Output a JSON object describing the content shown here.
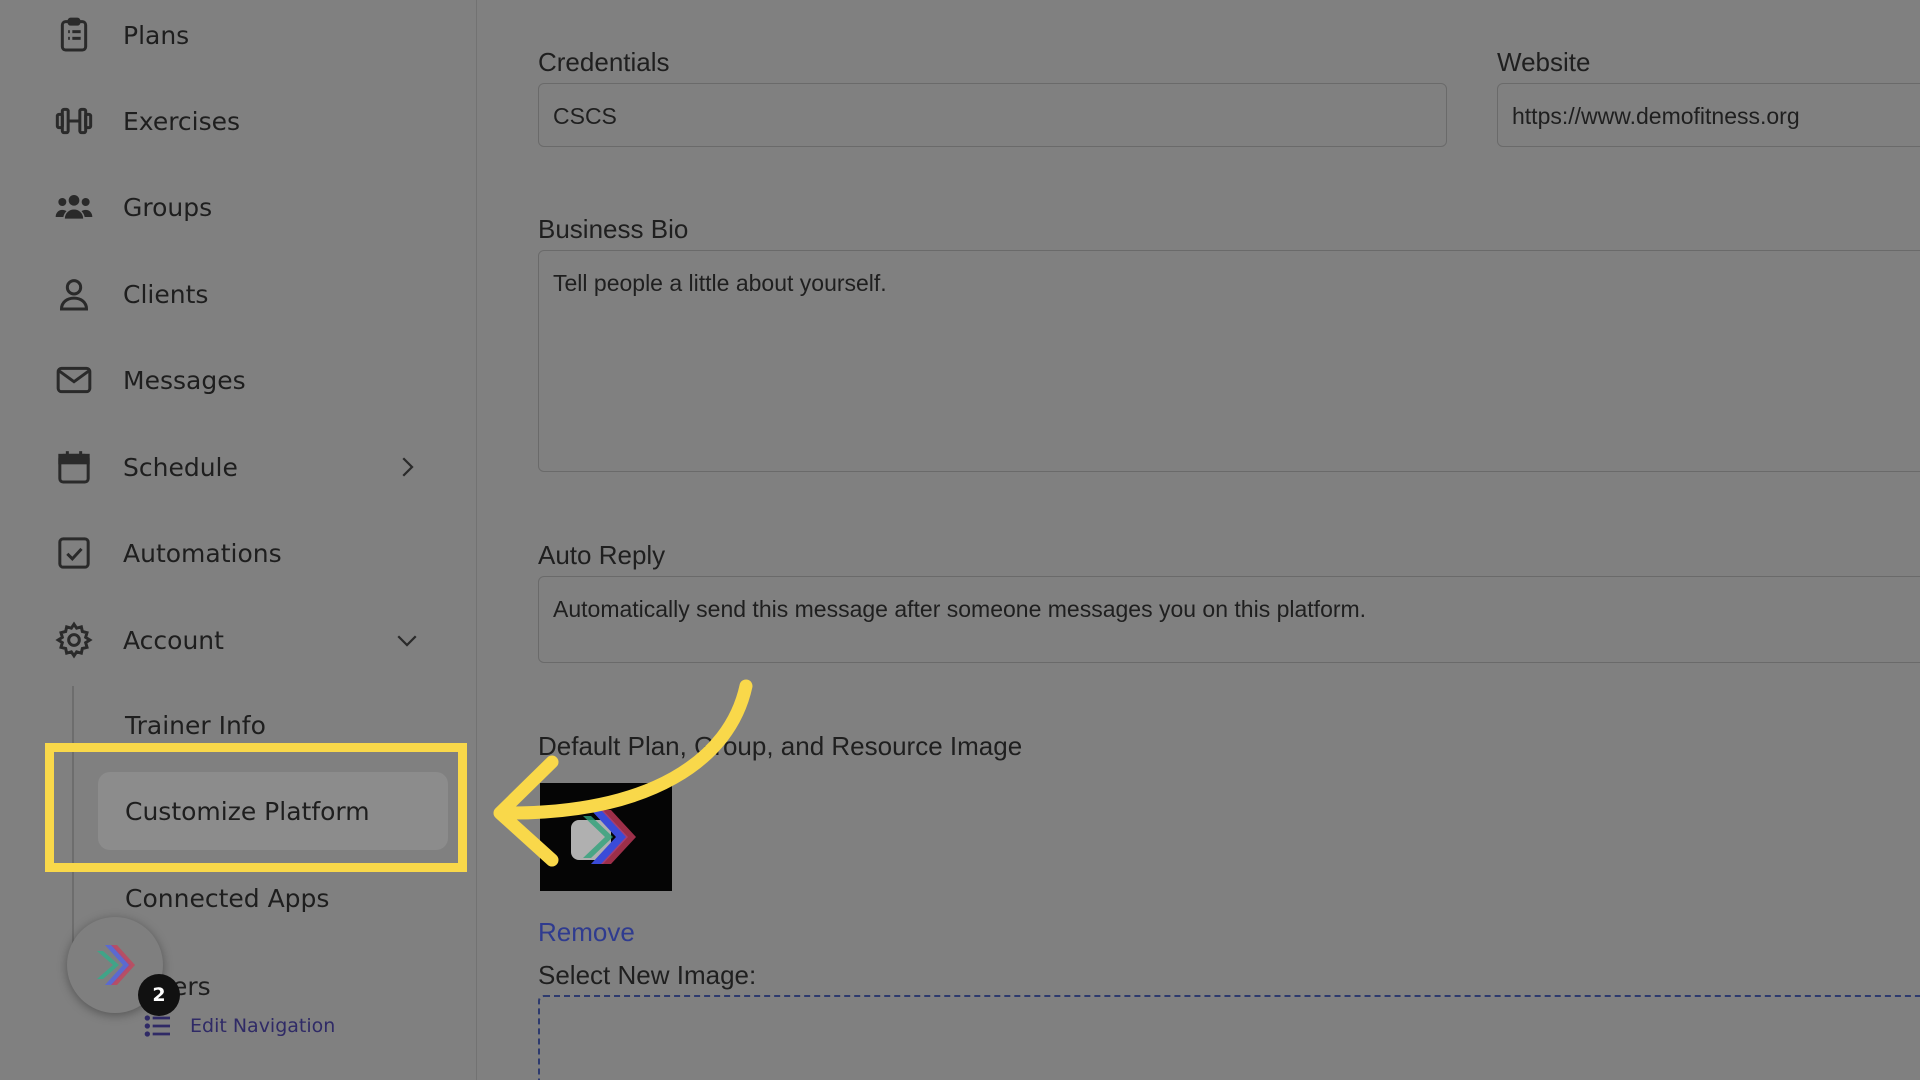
{
  "sidebar": {
    "items": [
      {
        "label": "Plans",
        "icon": "clipboard-icon"
      },
      {
        "label": "Exercises",
        "icon": "dumbbell-icon"
      },
      {
        "label": "Groups",
        "icon": "users-icon"
      },
      {
        "label": "Clients",
        "icon": "user-icon"
      },
      {
        "label": "Messages",
        "icon": "envelope-icon"
      },
      {
        "label": "Schedule",
        "icon": "calendar-icon"
      },
      {
        "label": "Automations",
        "icon": "checkbox-icon"
      },
      {
        "label": "Account",
        "icon": "gear-icon"
      }
    ],
    "sub_items": [
      {
        "label": "Trainer Info"
      },
      {
        "label": "Customize Platform"
      },
      {
        "label": "Connected Apps"
      },
      {
        "label": "ers"
      }
    ],
    "badge_count": "2",
    "edit_navigation": "Edit Navigation"
  },
  "form": {
    "credentials": {
      "label": "Credentials",
      "value": "CSCS"
    },
    "website": {
      "label": "Website",
      "value": "https://www.demofitness.org"
    },
    "business_bio": {
      "label": "Business Bio",
      "placeholder": "Tell people a little about yourself."
    },
    "auto_reply": {
      "label": "Auto Reply",
      "placeholder": "Automatically send this message after someone messages you on this platform."
    },
    "default_image": {
      "label": "Default Plan, Group, and Resource Image",
      "remove": "Remove",
      "select_new": "Select New Image:"
    }
  },
  "colors": {
    "highlight": "#f9d84a",
    "link": "#2f3b8f"
  }
}
